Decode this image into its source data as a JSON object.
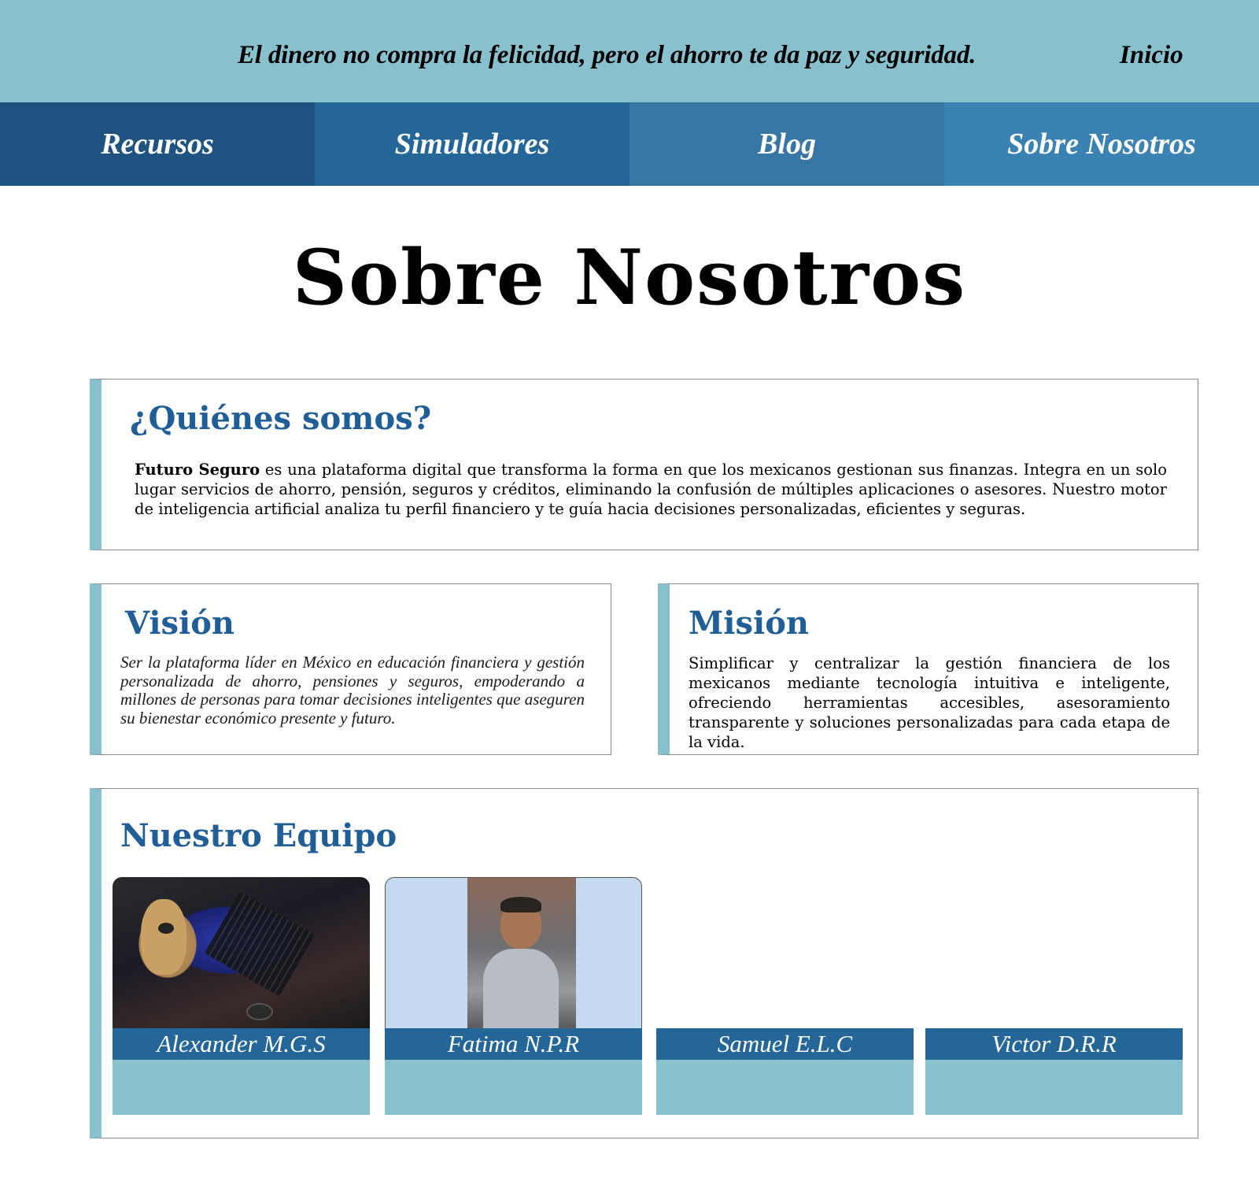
{
  "header": {
    "quote": "El dinero no compra la felicidad, pero el ahorro te da paz y seguridad.",
    "home_label": "Inicio"
  },
  "nav": {
    "items": [
      {
        "label": "Recursos"
      },
      {
        "label": "Simuladores"
      },
      {
        "label": "Blog"
      },
      {
        "label": "Sobre Nosotros"
      }
    ]
  },
  "page": {
    "title": "Sobre Nosotros"
  },
  "about": {
    "heading": "¿Quiénes somos?",
    "brand": "Futuro Seguro",
    "text": " es una plataforma digital que transforma la forma en que los mexicanos gestionan sus finanzas. Integra en un solo lugar servicios de ahorro, pensión, seguros y créditos, eliminando la confusión de múltiples aplicaciones o asesores. Nuestro motor de inteligencia artificial analiza tu perfil financiero y te guía hacia decisiones personalizadas, eficientes y seguras."
  },
  "vision": {
    "heading": "Visión",
    "text": "Ser la plataforma líder en México en educación financiera y gestión personalizada de ahorro, pensiones y seguros, empoderando a millones de personas para tomar decisiones inteligentes que aseguren su bienestar económico presente y futuro."
  },
  "mission": {
    "heading": "Misión",
    "text": "Simplificar y centralizar la gestión financiera de los mexicanos mediante tecnología intuitiva e inteligente, ofreciendo herramientas accesibles, asesoramiento transparente y soluciones personalizadas para cada etapa de la vida."
  },
  "team": {
    "heading": "Nuestro Equipo",
    "members": [
      {
        "name": "Alexander M.G.S"
      },
      {
        "name": "Fatima N.P.R"
      },
      {
        "name": "Samuel E.L.C"
      },
      {
        "name": "Victor D.R.R"
      }
    ]
  },
  "colors": {
    "top_bar": "#89c0cd",
    "nav_1": "#1f5480",
    "nav_2": "#246698",
    "nav_3": "#3776a3",
    "nav_4": "#3b82b4",
    "heading": "#1f5e96",
    "accent": "#89c0cd"
  }
}
